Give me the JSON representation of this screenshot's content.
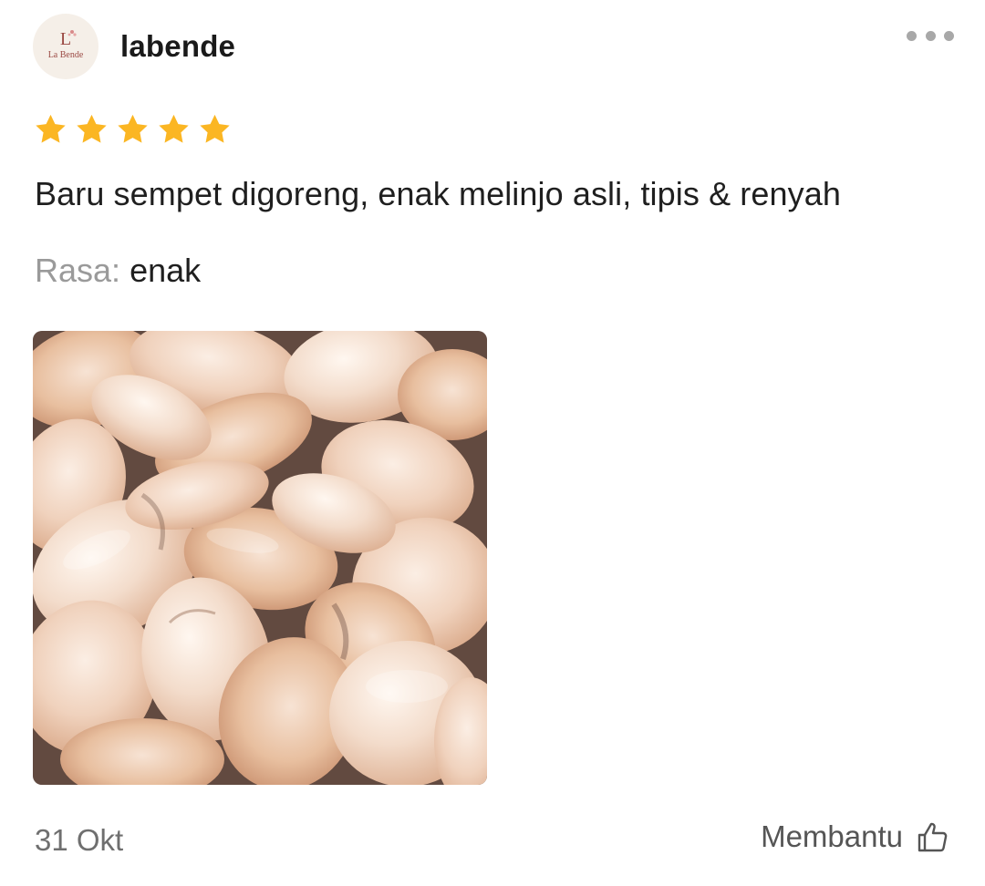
{
  "review": {
    "avatar_brand": "La Bende",
    "avatar_mark": "L",
    "username": "labende",
    "rating": 5,
    "rating_max": 5,
    "text": "Baru sempet digoreng, enak melinjo asli, tipis & renyah",
    "variant_label": "Rasa:",
    "variant_value": "enak",
    "date": "31 Okt",
    "helpful_label": "Membantu"
  },
  "colors": {
    "star": "#FBB623",
    "muted_text": "#9a9a9a",
    "icon_gray": "#a8a8a8"
  },
  "icons": {
    "more": "more-dots-icon",
    "helpful": "thumbs-up-icon",
    "star": "star-icon"
  }
}
